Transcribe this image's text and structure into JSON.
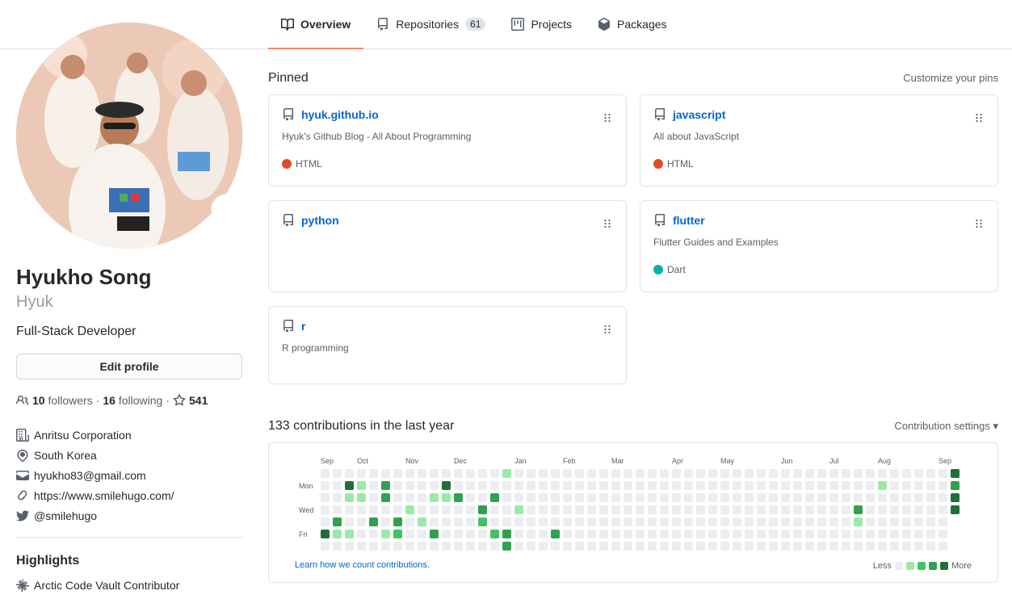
{
  "tabs": [
    {
      "label": "Overview",
      "icon": "book-icon",
      "active": true
    },
    {
      "label": "Repositories",
      "icon": "repo-icon",
      "count": "61"
    },
    {
      "label": "Projects",
      "icon": "project-icon"
    },
    {
      "label": "Packages",
      "icon": "package-icon"
    }
  ],
  "profile": {
    "name": "Hyukho Song",
    "login": "Hyuk",
    "bio": "Full-Stack Developer",
    "edit_label": "Edit profile",
    "followers": "10",
    "followers_label": "followers",
    "following": "16",
    "following_label": "following",
    "stars": "541",
    "company": "Anritsu Corporation",
    "location": "South Korea",
    "email": "hyukho83@gmail.com",
    "website": "https://www.smilehugo.com/",
    "twitter": "@smilehugo"
  },
  "highlights": {
    "title": "Highlights",
    "item": "Arctic Code Vault Contributor"
  },
  "pinned": {
    "title": "Pinned",
    "customize": "Customize your pins",
    "repos": [
      {
        "name": "hyuk.github.io",
        "desc": "Hyuk's Github Blog - All About Programming",
        "lang": "HTML",
        "color": "#e34c26"
      },
      {
        "name": "javascript",
        "desc": "All about JavaScript",
        "lang": "HTML",
        "color": "#e34c26"
      },
      {
        "name": "python",
        "desc": "",
        "lang": "",
        "color": ""
      },
      {
        "name": "flutter",
        "desc": "Flutter Guides and Examples",
        "lang": "Dart",
        "color": "#00B4AB"
      },
      {
        "name": "r",
        "desc": "R programming",
        "lang": "",
        "color": ""
      }
    ]
  },
  "contributions": {
    "title": "133 contributions in the last year",
    "settings": "Contribution settings ▾",
    "months": [
      "Sep",
      "Oct",
      "Nov",
      "Dec",
      "Jan",
      "Feb",
      "Mar",
      "Apr",
      "May",
      "Jun",
      "Jul",
      "Aug",
      "Sep"
    ],
    "days": [
      "Mon",
      "Wed",
      "Fri"
    ],
    "learn": "Learn how we count contributions.",
    "less": "Less",
    "more": "More",
    "colors": [
      "#ebedf0",
      "#9be9a8",
      "#40c463",
      "#30a14e",
      "#216e39"
    ]
  }
}
